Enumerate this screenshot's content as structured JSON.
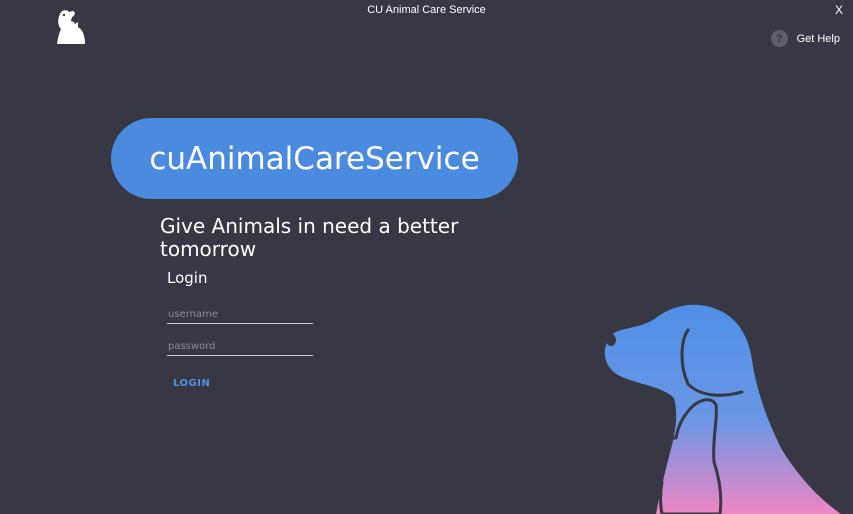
{
  "window": {
    "title": "CU Animal Care Service",
    "close_label": "X"
  },
  "help": {
    "icon": "question-icon",
    "icon_glyph": "?",
    "label": "Get Help"
  },
  "brand": {
    "name": "cuAnimalCareService",
    "tagline": "Give Animals in need a better tomorrow"
  },
  "login": {
    "heading": "Login",
    "username_placeholder": "username",
    "password_placeholder": "password",
    "button_label": "LOGIN"
  },
  "colors": {
    "background": "#373843",
    "accent": "#4a8be0",
    "illustration_gradient_start": "#4f8fe6",
    "illustration_gradient_end": "#ee86c4"
  }
}
